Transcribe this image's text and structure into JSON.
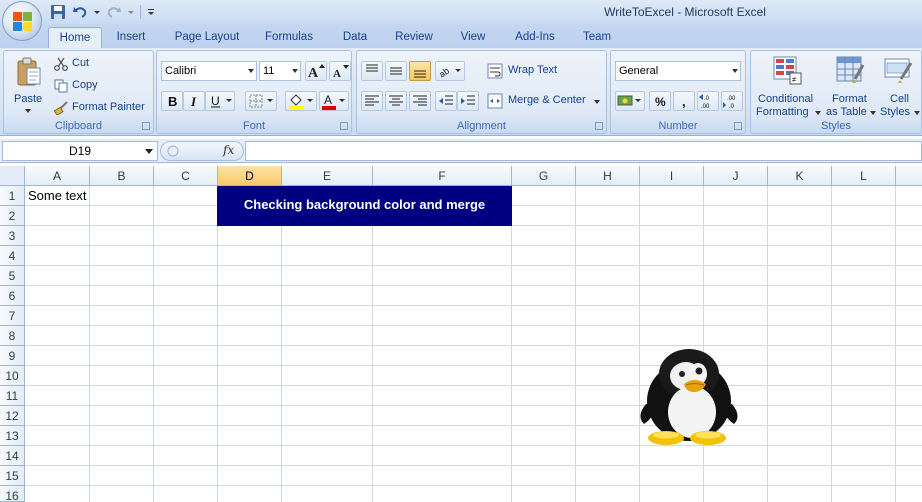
{
  "window": {
    "title": "WriteToExcel - Microsoft Excel"
  },
  "tabs": [
    "Home",
    "Insert",
    "Page Layout",
    "Formulas",
    "Data",
    "Review",
    "View",
    "Add-Ins",
    "Team"
  ],
  "active_tab": "Home",
  "ribbon": {
    "clipboard": {
      "label": "Clipboard",
      "paste": "Paste",
      "cut": "Cut",
      "copy": "Copy",
      "format_painter": "Format Painter"
    },
    "font": {
      "label": "Font",
      "name": "Calibri",
      "size": "11"
    },
    "alignment": {
      "label": "Alignment",
      "wrap_text": "Wrap Text",
      "merge_center": "Merge & Center"
    },
    "number": {
      "label": "Number",
      "format": "General",
      "percent": "%",
      "comma": ","
    },
    "styles": {
      "label": "Styles",
      "conditional_line1": "Conditional",
      "conditional_line2": "Formatting",
      "format_table_line1": "Format",
      "format_table_line2": "as Table",
      "cell_styles_line1": "Cell",
      "cell_styles_line2": "Styles"
    }
  },
  "formula_bar": {
    "name_box": "D19",
    "fx": "fx",
    "formula": ""
  },
  "sheet": {
    "columns": [
      "A",
      "B",
      "C",
      "D",
      "E",
      "F",
      "G",
      "H",
      "I",
      "J",
      "K",
      "L"
    ],
    "selected_column": "D",
    "rows": [
      "1",
      "2",
      "3",
      "4",
      "5",
      "6",
      "7",
      "8",
      "9",
      "10",
      "11",
      "12",
      "13",
      "14",
      "15",
      "16"
    ],
    "cell_a1": "Some text",
    "merged_cell_text": "Checking background color and merge",
    "merged_cell_bg": "#000080",
    "image": "penguin-image"
  },
  "colors": {
    "ribbon_bg": "#dae6f4",
    "accent": "#15428b",
    "selected_header": "#f8c86a"
  }
}
